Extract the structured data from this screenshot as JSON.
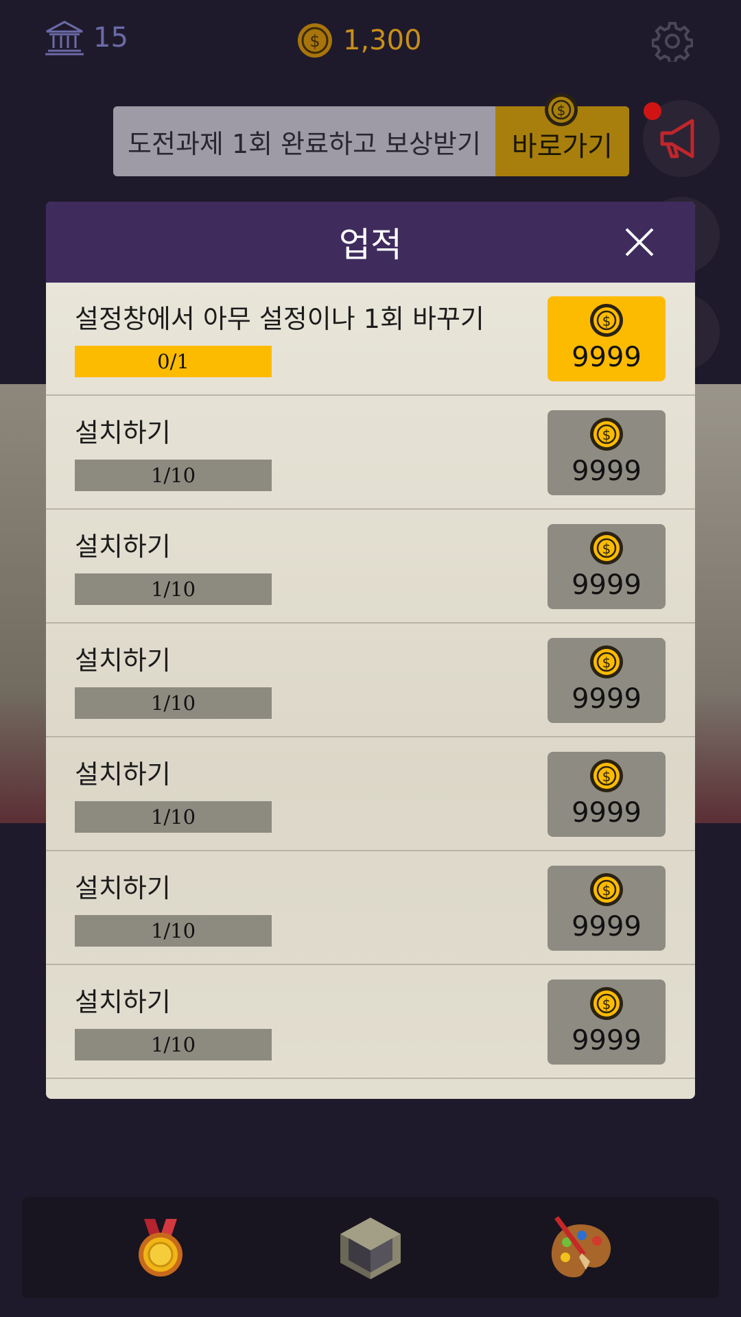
{
  "status": {
    "museum_level": "15",
    "coins": "1,300"
  },
  "banner": {
    "text": "도전과제 1회 완료하고 보상받기",
    "button_label": "바로가기"
  },
  "panel": {
    "title": "업적",
    "rows": [
      {
        "label": "설정창에서 아무 설정이나 1회 바꾸기",
        "progress": "0/1",
        "reward": "9999",
        "active": true
      },
      {
        "label": "설치하기",
        "progress": "1/10",
        "reward": "9999",
        "active": false
      },
      {
        "label": "설치하기",
        "progress": "1/10",
        "reward": "9999",
        "active": false
      },
      {
        "label": "설치하기",
        "progress": "1/10",
        "reward": "9999",
        "active": false
      },
      {
        "label": "설치하기",
        "progress": "1/10",
        "reward": "9999",
        "active": false
      },
      {
        "label": "설치하기",
        "progress": "1/10",
        "reward": "9999",
        "active": false
      },
      {
        "label": "설치하기",
        "progress": "1/10",
        "reward": "9999",
        "active": false
      }
    ]
  },
  "icons": {
    "museum": "museum-icon",
    "coin": "coin-icon",
    "settings": "gear-icon",
    "close": "close-icon",
    "megaphone": "megaphone-icon",
    "medal": "medal-icon",
    "cube": "cube-icon",
    "palette": "palette-icon"
  },
  "colors": {
    "accent_yellow": "#fdbb00",
    "header_purple": "#3f2c5d",
    "background": "#1f1a2b",
    "inactive_gray": "#8e8b83"
  }
}
